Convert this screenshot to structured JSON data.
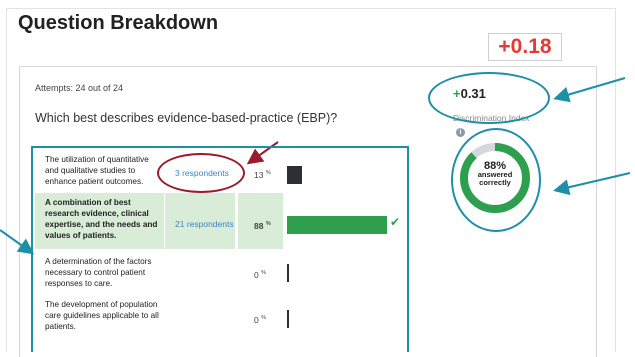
{
  "header": {
    "title": "Question Breakdown",
    "score": "+0.18"
  },
  "question": {
    "attempts": "Attempts: 24 out of 24",
    "text": "Which best describes evidence-based-practice (EBP)?"
  },
  "discrimination": {
    "sign": "+",
    "value": "0.31",
    "label": "Discrimination Index",
    "info_icon": "info-icon"
  },
  "donut": {
    "percent_text": "88%",
    "caption_line1": "answered",
    "caption_line2": "correctly",
    "percent_correct": 0.88,
    "colors": {
      "correct": "#2e9e4f",
      "remaining": "#d4d8dc"
    }
  },
  "answers": [
    {
      "text": "The utilization of quantitative and qualitative studies to enhance patient outcomes.",
      "respondents": "3 respondents",
      "percent": "13",
      "percent_value": 13,
      "correct": false
    },
    {
      "text": "A combination of best research evidence, clinical expertise, and the needs and values of patients.",
      "respondents": "21 respondents",
      "percent": "88",
      "percent_value": 88,
      "correct": true
    },
    {
      "text": "A determination of the factors necessary to control patient responses to care.",
      "respondents": "",
      "percent": "0",
      "percent_value": 0,
      "correct": false
    },
    {
      "text": "The development of population care guidelines applicable to all patients.",
      "respondents": "",
      "percent": "0",
      "percent_value": 0,
      "correct": false
    }
  ],
  "percent_symbol": "%",
  "colors": {
    "score_red": "#e53935",
    "annotation_teal": "#1d8fa6",
    "annotation_red": "#9a1b2c",
    "correct_green": "#2e9e4f",
    "correct_row_bg": "#d9ecd8",
    "respondent_link": "#3b87c6"
  }
}
